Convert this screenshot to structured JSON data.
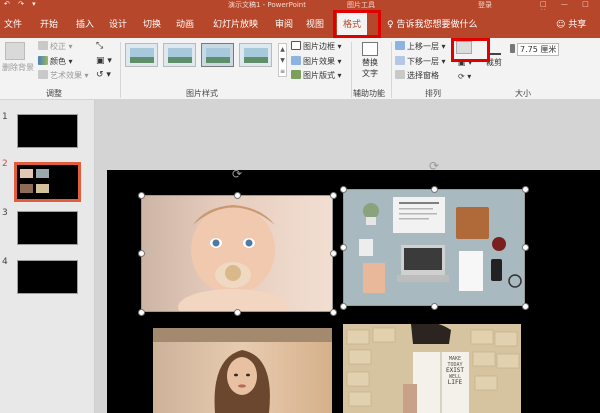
{
  "titlebar": {
    "qat": "↶ ↷ ▾",
    "doc_title": "演示文稿1 - PowerPoint",
    "context_label": "图片工具",
    "login": "登录",
    "window_buttons": "□ — □ ✕"
  },
  "tabs": [
    "文件",
    "开始",
    "插入",
    "设计",
    "切换",
    "动画",
    "幻灯片放映",
    "审阅",
    "视图",
    "格式"
  ],
  "tell_me": "♀ 告诉我您想要做什么",
  "share": "☺ 共享",
  "ribbon": {
    "remove_bg": "删除背景",
    "corrections": "校正",
    "color": "颜色",
    "artistic": "艺术效果",
    "adjust_label": "调整",
    "picture_styles_label": "图片样式",
    "border": "图片边框",
    "effects": "图片效果",
    "layout": "图片版式",
    "alt_text_1": "替换",
    "alt_text_2": "文字",
    "accessibility_label": "辅助功能",
    "bring_forward": "上移一层",
    "send_backward": "下移一层",
    "selection_pane": "选择窗格",
    "arrange_label": "排列",
    "crop": "裁剪",
    "height_value": "7.75 厘米",
    "size_label": "大小"
  },
  "slides": [
    {
      "number": "1"
    },
    {
      "number": "2"
    },
    {
      "number": "3"
    },
    {
      "number": "4"
    }
  ],
  "book_text": [
    "MAKE",
    "TODAY",
    "EXIST",
    "WELL",
    "LIFE"
  ],
  "colors": {
    "brand": "#b7472a",
    "highlight": "#e00000",
    "slide_bg": "#000000",
    "thumb_active": "#e05d3d"
  }
}
